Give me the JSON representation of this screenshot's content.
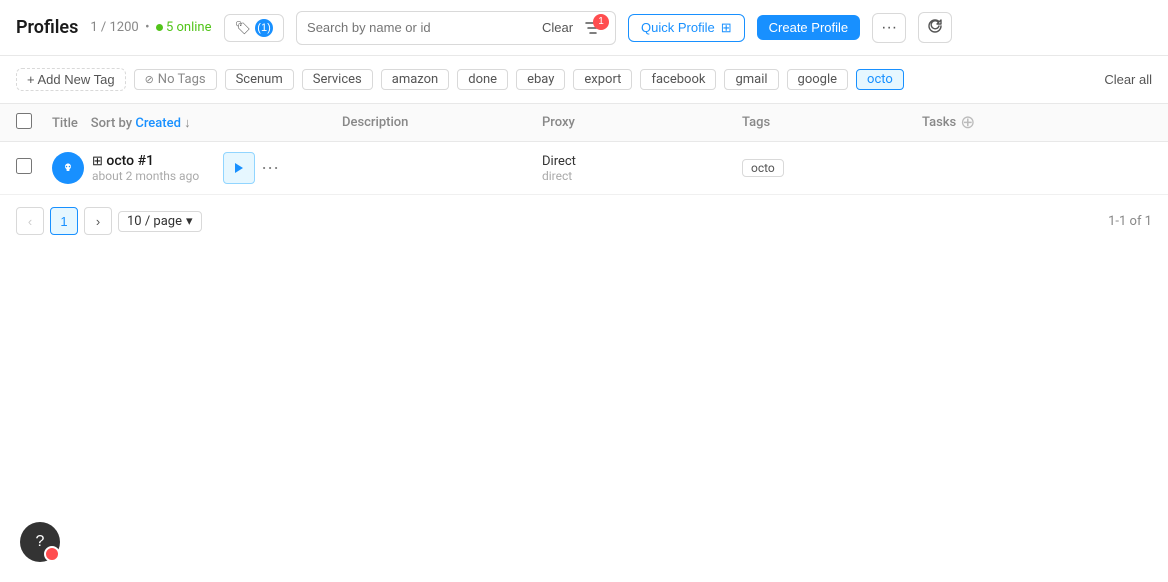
{
  "header": {
    "title": "Profiles",
    "count": "1 / 1200",
    "online_count": "5 online",
    "tag_filter_label": "(1)",
    "search_placeholder": "Search by name or id",
    "clear_label": "Clear",
    "filter_badge": "1",
    "quick_profile_label": "Quick Profile",
    "create_profile_label": "Create Profile",
    "more_label": "···",
    "refresh_icon": "↻"
  },
  "tags_bar": {
    "add_tag_label": "+ Add New Tag",
    "tags": [
      {
        "id": "no-tags",
        "label": "No Tags",
        "has_icon": true,
        "active": false
      },
      {
        "id": "scenum",
        "label": "Scenum",
        "active": false
      },
      {
        "id": "services",
        "label": "Services",
        "active": false
      },
      {
        "id": "amazon",
        "label": "amazon",
        "active": false
      },
      {
        "id": "done",
        "label": "done",
        "active": false
      },
      {
        "id": "ebay",
        "label": "ebay",
        "active": false
      },
      {
        "id": "export",
        "label": "export",
        "active": false
      },
      {
        "id": "facebook",
        "label": "facebook",
        "active": false
      },
      {
        "id": "gmail",
        "label": "gmail",
        "active": false
      },
      {
        "id": "google",
        "label": "google",
        "active": false
      },
      {
        "id": "octo",
        "label": "octo",
        "active": true
      }
    ],
    "clear_all_label": "Clear all"
  },
  "table": {
    "columns": {
      "title": "Title",
      "sort_by": "Sort by",
      "sort_field": "Created",
      "description": "Description",
      "proxy": "Proxy",
      "tags": "Tags",
      "tasks": "Tasks"
    },
    "rows": [
      {
        "id": "octo-1",
        "name": "octo #1",
        "time": "about 2 months ago",
        "os": "windows",
        "description": "",
        "proxy_main": "Direct",
        "proxy_sub": "direct",
        "tags": [
          "octo"
        ],
        "tasks": []
      }
    ]
  },
  "pagination": {
    "prev_label": "‹",
    "next_label": "›",
    "current_page": 1,
    "page_size": "10 / page",
    "info": "1-1 of 1"
  },
  "help": {
    "icon": "?"
  }
}
